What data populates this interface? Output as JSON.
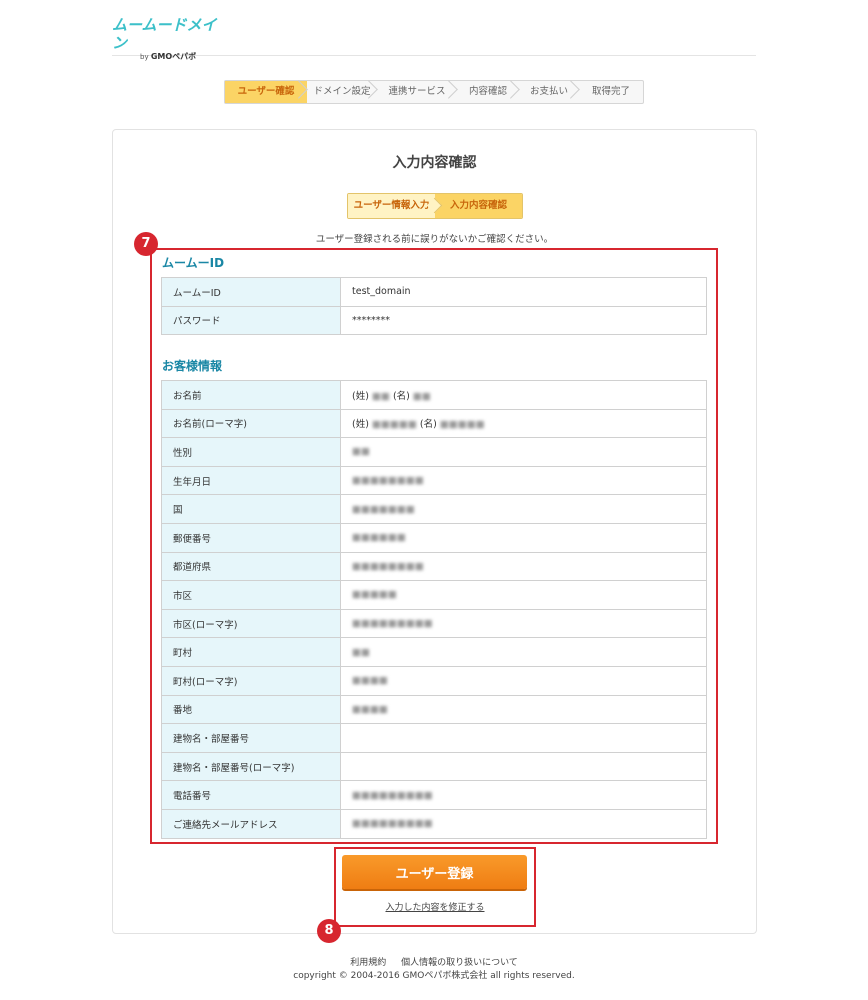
{
  "brand": {
    "logo_text": "ムームードメイン",
    "byline_prefix": "by",
    "byline_company": "GMOペパボ"
  },
  "progress_steps": [
    {
      "label": "ユーザー確認",
      "active": true
    },
    {
      "label": "ドメイン設定",
      "active": false
    },
    {
      "label": "連携サービス",
      "active": false
    },
    {
      "label": "内容確認",
      "active": false
    },
    {
      "label": "お支払い",
      "active": false
    },
    {
      "label": "取得完了",
      "active": false
    }
  ],
  "page_title": "入力内容確認",
  "sub_steps": [
    {
      "label": "ユーザー情報入力",
      "active": false
    },
    {
      "label": "入力内容確認",
      "active": true
    }
  ],
  "notice": "ユーザー登録される前に誤りがないかご確認ください。",
  "badges": {
    "b7": "7",
    "b8": "8"
  },
  "sections": {
    "muumuu_id": {
      "title": "ムームーID",
      "rows": [
        {
          "label": "ムームーID",
          "value": "test_domain"
        },
        {
          "label": "パスワード",
          "value": "********"
        }
      ]
    },
    "customer": {
      "title": "お客様情報",
      "rows": [
        {
          "label": "お名前",
          "prefix": "(姓)",
          "value": "■■",
          "mid": "(名)",
          "value2": "■■"
        },
        {
          "label": "お名前(ローマ字)",
          "prefix": "(姓)",
          "value": "■■■■■",
          "mid": "(名)",
          "value2": "■■■■■"
        },
        {
          "label": "性別",
          "value": "■■"
        },
        {
          "label": "生年月日",
          "value": "■■■■■■■■"
        },
        {
          "label": "国",
          "value": "■■■■■■■"
        },
        {
          "label": "郵便番号",
          "value": "■■■■■■"
        },
        {
          "label": "都道府県",
          "value": "■■■■■■■■"
        },
        {
          "label": "市区",
          "value": "■■■■■"
        },
        {
          "label": "市区(ローマ字)",
          "value": "■■■■■■■■■"
        },
        {
          "label": "町村",
          "value": "■■"
        },
        {
          "label": "町村(ローマ字)",
          "value": "■■■■"
        },
        {
          "label": "番地",
          "value": "■■■■"
        },
        {
          "label": "建物名・部屋番号",
          "value": ""
        },
        {
          "label": "建物名・部屋番号(ローマ字)",
          "value": ""
        },
        {
          "label": "電話番号",
          "value": "■■■■■■■■■"
        },
        {
          "label": "ご連絡先メールアドレス",
          "value": "■■■■■■■■■"
        }
      ]
    }
  },
  "actions": {
    "submit_label": "ユーザー登録",
    "edit_link": "入力した内容を修正する"
  },
  "footer": {
    "links": [
      "利用規約",
      "個人情報の取り扱いについて"
    ],
    "copyright": "copyright © 2004-2016 GMOペパボ株式会社 all rights reserved."
  },
  "colors": {
    "accent_orange": "#ef7d13",
    "highlight_red": "#d7262f",
    "section_teal": "#1a87a5",
    "label_bg": "#e6f6fa",
    "logo_teal": "#3cc0c9"
  }
}
